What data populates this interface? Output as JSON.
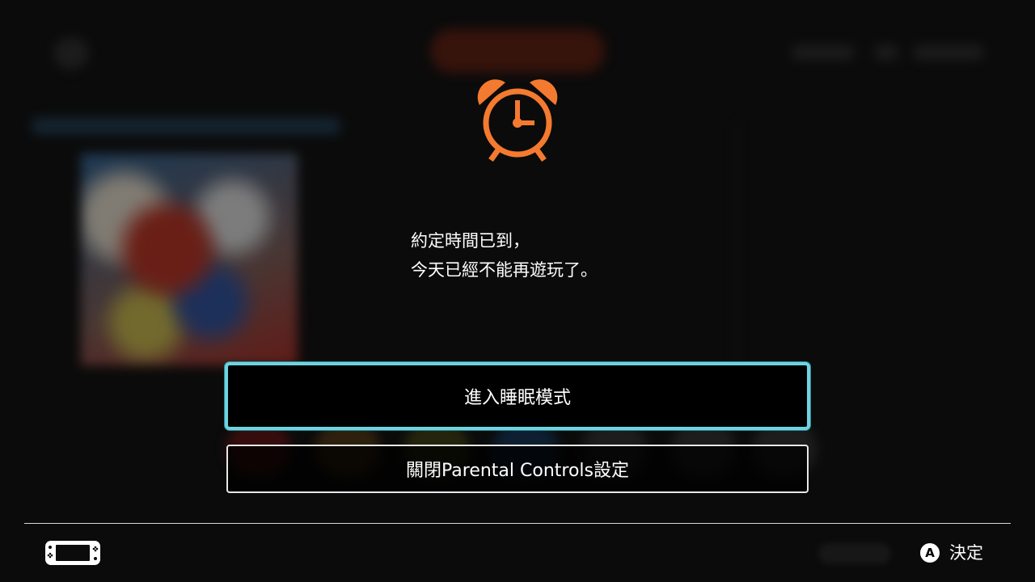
{
  "dialog": {
    "message_line1": "約定時間已到，",
    "message_line2": "今天已經不能再遊玩了。",
    "icon": "alarm-clock-icon",
    "accent_color": "#f47a2f"
  },
  "buttons": {
    "sleep_label": "進入睡眠模式",
    "disable_parental_label": "關閉Parental Controls設定",
    "focus_color": "#6fd3e0"
  },
  "footer": {
    "console_icon": "handheld-console-icon",
    "a_button_glyph": "A",
    "a_button_label": "決定"
  }
}
